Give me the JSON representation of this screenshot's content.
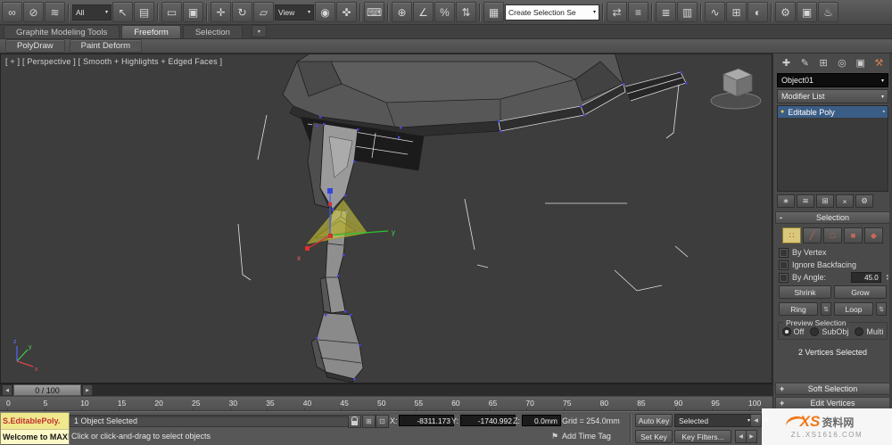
{
  "glyphs": {
    "dropdown_arrow": "▾",
    "spinner_up": "▴",
    "spinner_down": "▾",
    "spinner_updown": "⇅",
    "track_left": "◀",
    "track_right": "▶",
    "rollout_collapse": "-",
    "rollout_expand": "+",
    "bulb": "●",
    "stack_corner": "▪",
    "tag": "⚑",
    "mini_prev": "◀",
    "mini_next": "▶",
    "ribbon_min": "▾"
  },
  "toolbar": {
    "items": [
      {
        "t": "icon",
        "n": "select-and-link-icon",
        "g": "∞"
      },
      {
        "t": "icon",
        "n": "unlink-selection-icon",
        "g": "⊘"
      },
      {
        "t": "icon",
        "n": "bind-to-space-warp-icon",
        "g": "≋"
      },
      {
        "t": "sep"
      },
      {
        "t": "dd",
        "n": "selection-filter-dropdown",
        "label": "All",
        "style": "dark"
      },
      {
        "t": "icon",
        "n": "select-object-icon",
        "g": "↖"
      },
      {
        "t": "icon",
        "n": "select-by-name-icon",
        "g": "▤"
      },
      {
        "t": "sep"
      },
      {
        "t": "icon",
        "n": "rectangular-selection-region-icon",
        "g": "▭"
      },
      {
        "t": "icon",
        "n": "window-crossing-icon",
        "g": "▣"
      },
      {
        "t": "sep"
      },
      {
        "t": "icon",
        "n": "select-and-move-icon",
        "g": "✛"
      },
      {
        "t": "icon",
        "n": "select-and-rotate-icon",
        "g": "↻"
      },
      {
        "t": "icon",
        "n": "select-and-scale-icon",
        "g": "▱"
      },
      {
        "t": "dd",
        "n": "reference-coordinate-dropdown",
        "label": "View",
        "style": "dark"
      },
      {
        "t": "icon",
        "n": "use-pivot-center-icon",
        "g": "◉"
      },
      {
        "t": "icon",
        "n": "select-and-manipulate-icon",
        "g": "✜"
      },
      {
        "t": "sep"
      },
      {
        "t": "icon",
        "n": "keyboard-override-icon",
        "g": "⌨"
      },
      {
        "t": "sep"
      },
      {
        "t": "icon",
        "n": "snaps-toggle-icon",
        "g": "⊕"
      },
      {
        "t": "icon",
        "n": "angle-snap-icon",
        "g": "∠"
      },
      {
        "t": "icon",
        "n": "percent-snap-icon",
        "g": "%"
      },
      {
        "t": "icon",
        "n": "spinner-snap-icon",
        "g": "⇅"
      },
      {
        "t": "sep"
      },
      {
        "t": "icon",
        "n": "named-selection-sets-icon",
        "g": "▦"
      },
      {
        "t": "dd",
        "n": "named-selection-set-dropdown",
        "label": "Create Selection Se",
        "style": "light"
      },
      {
        "t": "sep"
      },
      {
        "t": "icon",
        "n": "mirror-icon",
        "g": "⇄"
      },
      {
        "t": "icon",
        "n": "align-icon",
        "g": "≡"
      },
      {
        "t": "sep"
      },
      {
        "t": "icon",
        "n": "layer-manager-icon",
        "g": "≣"
      },
      {
        "t": "icon",
        "n": "graphite-toggle-icon",
        "g": "▥"
      },
      {
        "t": "sep"
      },
      {
        "t": "icon",
        "n": "curve-editor-icon",
        "g": "∿"
      },
      {
        "t": "icon",
        "n": "schematic-view-icon",
        "g": "⊞"
      },
      {
        "t": "icon",
        "n": "material-editor-icon",
        "g": "◐"
      },
      {
        "t": "sep"
      },
      {
        "t": "icon",
        "n": "render-setup-icon",
        "g": "⚙"
      },
      {
        "t": "icon",
        "n": "rendered-frame-icon",
        "g": "▣"
      },
      {
        "t": "icon",
        "n": "render-production-icon",
        "g": "♨"
      }
    ]
  },
  "ribbon": {
    "tabs": [
      {
        "label": "Graphite Modeling Tools",
        "active": false
      },
      {
        "label": "Freeform",
        "active": true
      },
      {
        "label": "Selection",
        "active": false
      }
    ],
    "panels": [
      {
        "label": "PolyDraw"
      },
      {
        "label": "Paint Deform"
      }
    ]
  },
  "viewport": {
    "label": "[ + ] [ Perspective ] [ Smooth + Highlights + Edged Faces ]",
    "axes": {
      "x": "x",
      "y": "y"
    },
    "tripod": {
      "x": "x",
      "y": "y",
      "z": "z"
    }
  },
  "command_panel": {
    "tabs": [
      {
        "n": "tab-create-icon",
        "g": "✚"
      },
      {
        "n": "tab-modify-icon",
        "g": "✎"
      },
      {
        "n": "tab-hierarchy-icon",
        "g": "⊞"
      },
      {
        "n": "tab-motion-icon",
        "g": "◎"
      },
      {
        "n": "tab-display-icon",
        "g": "▣"
      },
      {
        "n": "tab-utilities-icon",
        "g": "⚒",
        "c": "#d08050"
      }
    ],
    "object_name": "Object01",
    "modifier_list": "Modifier List",
    "stack": [
      {
        "label": "Editable Poly",
        "selected": true
      }
    ],
    "stack_tools": [
      {
        "n": "pin-stack-icon",
        "g": "∗"
      },
      {
        "n": "show-end-result-icon",
        "g": "≋"
      },
      {
        "n": "make-unique-icon",
        "g": "⊞"
      },
      {
        "n": "remove-modifier-icon",
        "g": "×"
      },
      {
        "n": "configure-modifier-sets-icon",
        "g": "⚙"
      }
    ],
    "selection_rollout": {
      "title": "Selection",
      "subobject": [
        {
          "n": "vertex-mode-button",
          "g": "∷",
          "active": true
        },
        {
          "n": "edge-mode-button",
          "g": "╱",
          "active": false
        },
        {
          "n": "border-mode-button",
          "g": "□",
          "active": false
        },
        {
          "n": "polygon-mode-button",
          "g": "■",
          "active": false
        },
        {
          "n": "element-mode-button",
          "g": "◆",
          "active": false
        }
      ],
      "by_vertex": "By Vertex",
      "ignore_backfacing": "Ignore Backfacing",
      "by_angle": "By Angle:",
      "angle_value": "45.0",
      "shrink": "Shrink",
      "grow": "Grow",
      "ring": "Ring",
      "loop": "Loop",
      "preview_title": "Preview Selection",
      "radio_off": "Off",
      "radio_subobj": "SubObj",
      "radio_multi": "Multi",
      "status": "2 Vertices Selected"
    },
    "rollouts": [
      {
        "label": "Soft Selection"
      },
      {
        "label": "Edit Vertices"
      }
    ]
  },
  "timeline": {
    "slider_label": "0 / 100",
    "ticks": [
      "0",
      "5",
      "10",
      "15",
      "20",
      "25",
      "30",
      "35",
      "40",
      "45",
      "50",
      "55",
      "60",
      "65",
      "70",
      "75",
      "80",
      "85",
      "90",
      "95",
      "100"
    ]
  },
  "listener": {
    "line1": "S.EditablePoly.",
    "line2": "Welcome to MAX!"
  },
  "statusbar": {
    "selected_text": "1 Object Selected",
    "x_label": "X:",
    "x_value": "-8311.173",
    "y_label": "Y:",
    "y_value": "-1740.992",
    "z_label": "Z:",
    "z_value": "0.0mm",
    "grid_text": "Grid = 254.0mm",
    "prompt": "Click or click-and-drag to select objects",
    "add_time_tag": "Add Time Tag",
    "auto_key": "Auto Key",
    "selected_set": "Selected",
    "set_key": "Set Key",
    "key_filters": "Key Filters..."
  },
  "watermark": {
    "xs": "XS",
    "cn": "资料网",
    "url": "ZL.XS1616.COM"
  }
}
